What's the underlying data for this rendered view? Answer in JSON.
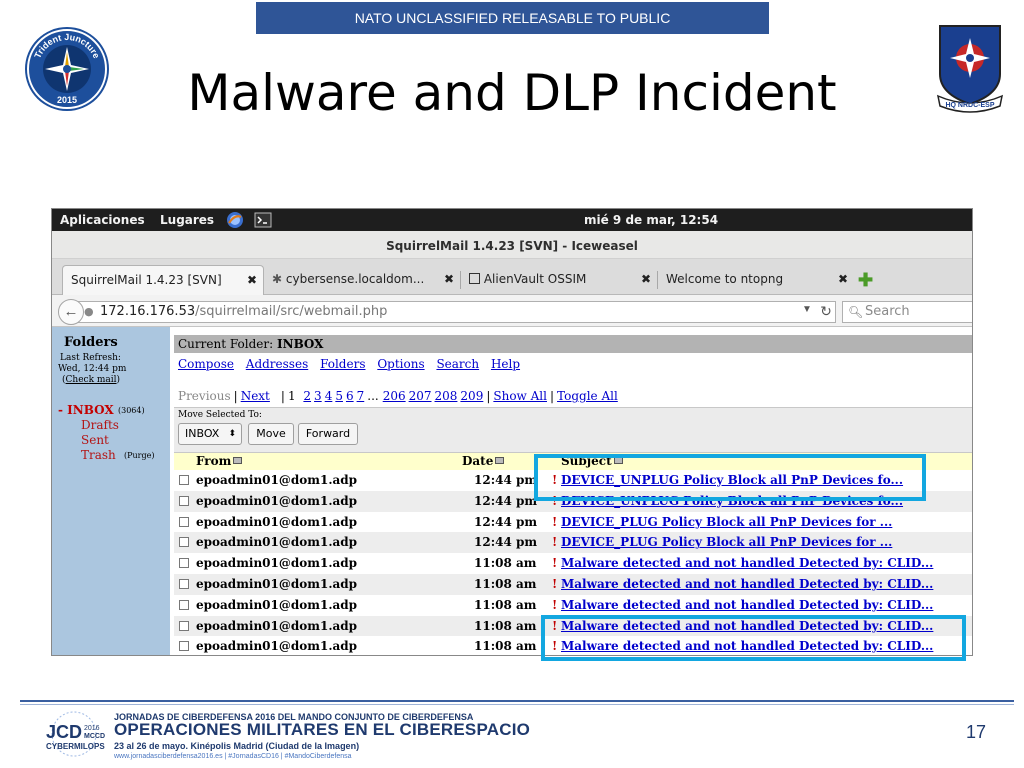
{
  "slide": {
    "banner": "NATO UNCLASSIFIED RELEASABLE TO PUBLIC",
    "title": "Malware and DLP Incident",
    "left_logo": {
      "top_text": "Trident Juncture",
      "year": "2015"
    },
    "right_logo": {
      "motto": "HQ NRDC-ESP"
    },
    "footer": {
      "line1": "JORNADAS DE CIBERDEFENSA 2016 DEL MANDO CONJUNTO DE CIBERDEFENSA",
      "line2": "OPERACIONES MILITARES EN EL CIBERESPACIO",
      "line3": "23 al 26 de mayo. Kinépolis Madrid (Ciudad de la Imagen)",
      "line4": "www.jornadasciberdefensa2016.es  |  #JornadasCD16  |  #MandoCiberdefensa",
      "logo_jcd": "JCD",
      "logo_year": "2016",
      "logo_mccd": "MCCD",
      "logo_cyber": "CYBERMILOPS"
    },
    "page_number": "17"
  },
  "desktop": {
    "menu_apps": "Aplicaciones",
    "menu_places": "Lugares",
    "clock": "mié  9 de mar, 12:54"
  },
  "browser": {
    "window_title": "SquirrelMail 1.4.23 [SVN] - Iceweasel",
    "tabs": [
      {
        "label": "SquirrelMail 1.4.23 [SVN]"
      },
      {
        "label": "cybersense.localdom..."
      },
      {
        "label": "AlienVault OSSIM"
      },
      {
        "label": "Welcome to ntopng"
      }
    ],
    "tab_close": "✖",
    "new_tab": "✚",
    "url_host": "172.16.176.53",
    "url_path": "/squirrelmail/src/webmail.php",
    "search_placeholder": "Search"
  },
  "mail": {
    "sidebar": {
      "title": "Folders",
      "last_refresh_label": "Last Refresh:",
      "last_refresh_time": "Wed, 12:44 pm",
      "check_mail": "Check mail",
      "inbox": "INBOX",
      "inbox_count": "(3064)",
      "drafts": "Drafts",
      "sent": "Sent",
      "trash": "Trash",
      "purge": "(Purge)"
    },
    "current_folder_label": "Current Folder:",
    "current_folder": "INBOX",
    "nav": [
      "Compose",
      "Addresses",
      "Folders",
      "Options",
      "Search",
      "Help"
    ],
    "pager": {
      "previous": "Previous",
      "next": "Next",
      "current": "1",
      "pages": [
        "2",
        "3",
        "4",
        "5",
        "6",
        "7"
      ],
      "ellipsis": "...",
      "more_pages": [
        "206",
        "207",
        "208",
        "209"
      ],
      "show_all": "Show All",
      "toggle_all": "Toggle All"
    },
    "move_selected_label": "Move Selected To:",
    "move_target": "INBOX",
    "move_button": "Move",
    "forward_button": "Forward",
    "columns": {
      "from": "From",
      "date": "Date",
      "subject": "Subject"
    },
    "messages": [
      {
        "from": "epoadmin01@dom1.adp",
        "date": "12:44 pm",
        "flag": "!",
        "subject": "DEVICE_UNPLUG Policy Block all PnP Devices fo..."
      },
      {
        "from": "epoadmin01@dom1.adp",
        "date": "12:44 pm",
        "flag": "!",
        "subject": "DEVICE_UNPLUG Policy Block all PnP Devices fo..."
      },
      {
        "from": "epoadmin01@dom1.adp",
        "date": "12:44 pm",
        "flag": "!",
        "subject": "DEVICE_PLUG Policy Block all PnP Devices for ..."
      },
      {
        "from": "epoadmin01@dom1.adp",
        "date": "12:44 pm",
        "flag": "!",
        "subject": "DEVICE_PLUG Policy Block all PnP Devices for ..."
      },
      {
        "from": "epoadmin01@dom1.adp",
        "date": "11:08 am",
        "flag": "!",
        "subject": "Malware detected and not handled Detected by: CLID..."
      },
      {
        "from": "epoadmin01@dom1.adp",
        "date": "11:08 am",
        "flag": "!",
        "subject": "Malware detected and not handled Detected by: CLID..."
      },
      {
        "from": "epoadmin01@dom1.adp",
        "date": "11:08 am",
        "flag": "!",
        "subject": "Malware detected and not handled Detected by: CLID..."
      },
      {
        "from": "epoadmin01@dom1.adp",
        "date": "11:08 am",
        "flag": "!",
        "subject": "Malware detected and not handled Detected by: CLID..."
      },
      {
        "from": "epoadmin01@dom1.adp",
        "date": "11:08 am",
        "flag": "!",
        "subject": "Malware detected and not handled Detected by: CLID..."
      }
    ]
  },
  "colors": {
    "banner": "#2f5597",
    "highlight": "#13a7e0",
    "sidebar": "#abc6df",
    "link": "#0000cc",
    "flag": "#c00000"
  }
}
